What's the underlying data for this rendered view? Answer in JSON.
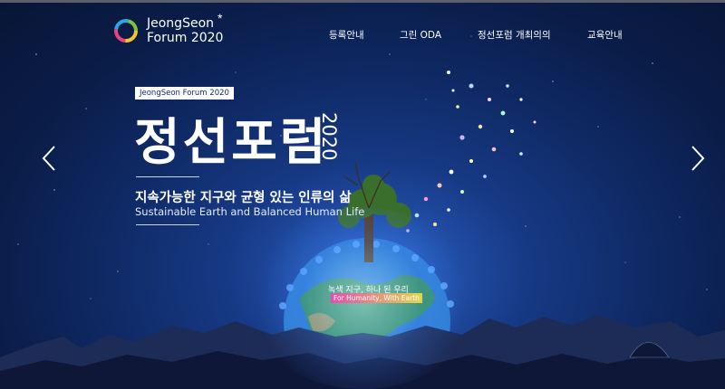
{
  "logo": {
    "line1": "JeongSeon",
    "line2": "Forum 2020"
  },
  "nav": [
    "등록안내",
    "그린 ODA",
    "정선포럼 개최의의",
    "교육안내"
  ],
  "hero": {
    "badge": "JeongSeon Forum 2020",
    "title": "정선포럼",
    "year": "2020",
    "subtitle_ko": "지속가능한 지구와 균형 있는 인류의 삶",
    "subtitle_en": "Sustainable Earth and Balanced Human Life",
    "globe_ko": "녹색 지구, 하나 된 우리",
    "globe_en": "For Humanity, With Earth"
  },
  "icons": {
    "prev": "chevron-left-icon",
    "next": "chevron-right-icon"
  }
}
